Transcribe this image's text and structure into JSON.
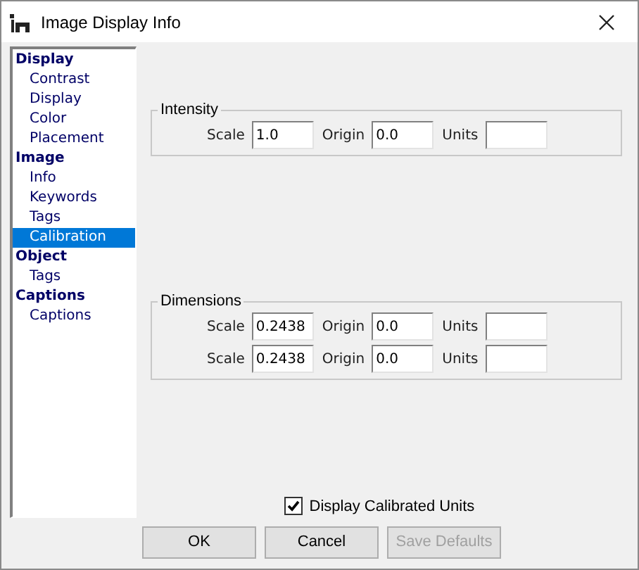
{
  "window": {
    "title": "Image Display Info"
  },
  "sidebar": {
    "items": [
      {
        "label": "Display",
        "selected": false,
        "children": [
          {
            "label": "Contrast",
            "selected": false
          },
          {
            "label": "Display",
            "selected": false
          },
          {
            "label": "Color",
            "selected": false
          },
          {
            "label": "Placement",
            "selected": false
          }
        ]
      },
      {
        "label": "Image",
        "selected": false,
        "children": [
          {
            "label": "Info",
            "selected": false
          },
          {
            "label": "Keywords",
            "selected": false
          },
          {
            "label": "Tags",
            "selected": false
          },
          {
            "label": "Calibration",
            "selected": true
          }
        ]
      },
      {
        "label": "Object",
        "selected": false,
        "children": [
          {
            "label": "Tags",
            "selected": false
          }
        ]
      },
      {
        "label": "Captions",
        "selected": false,
        "children": [
          {
            "label": "Captions",
            "selected": false
          }
        ]
      }
    ]
  },
  "intensity": {
    "title": "Intensity",
    "rows": [
      {
        "fields": [
          {
            "label": "Scale",
            "value": "1.0"
          },
          {
            "label": "Origin",
            "value": "0.0"
          },
          {
            "label": "Units"
          }
        ]
      }
    ]
  },
  "dimensions": {
    "title": "Dimensions",
    "rows": [
      {
        "fields": [
          {
            "label": "Scale",
            "value": "0.2438"
          },
          {
            "label": "Origin",
            "value": "0.0"
          },
          {
            "label": "Units"
          }
        ]
      },
      {
        "fields": [
          {
            "label": "Scale",
            "value": "0.2438"
          },
          {
            "label": "Origin",
            "value": "0.0"
          },
          {
            "label": "Units"
          }
        ]
      }
    ]
  },
  "display_calibrated_units": {
    "label": "Display Calibrated Units",
    "checked": true
  },
  "buttons": [
    {
      "label": "OK",
      "disabled": false
    },
    {
      "label": "Cancel",
      "disabled": false
    },
    {
      "label": "Save Defaults",
      "disabled": true
    }
  ]
}
